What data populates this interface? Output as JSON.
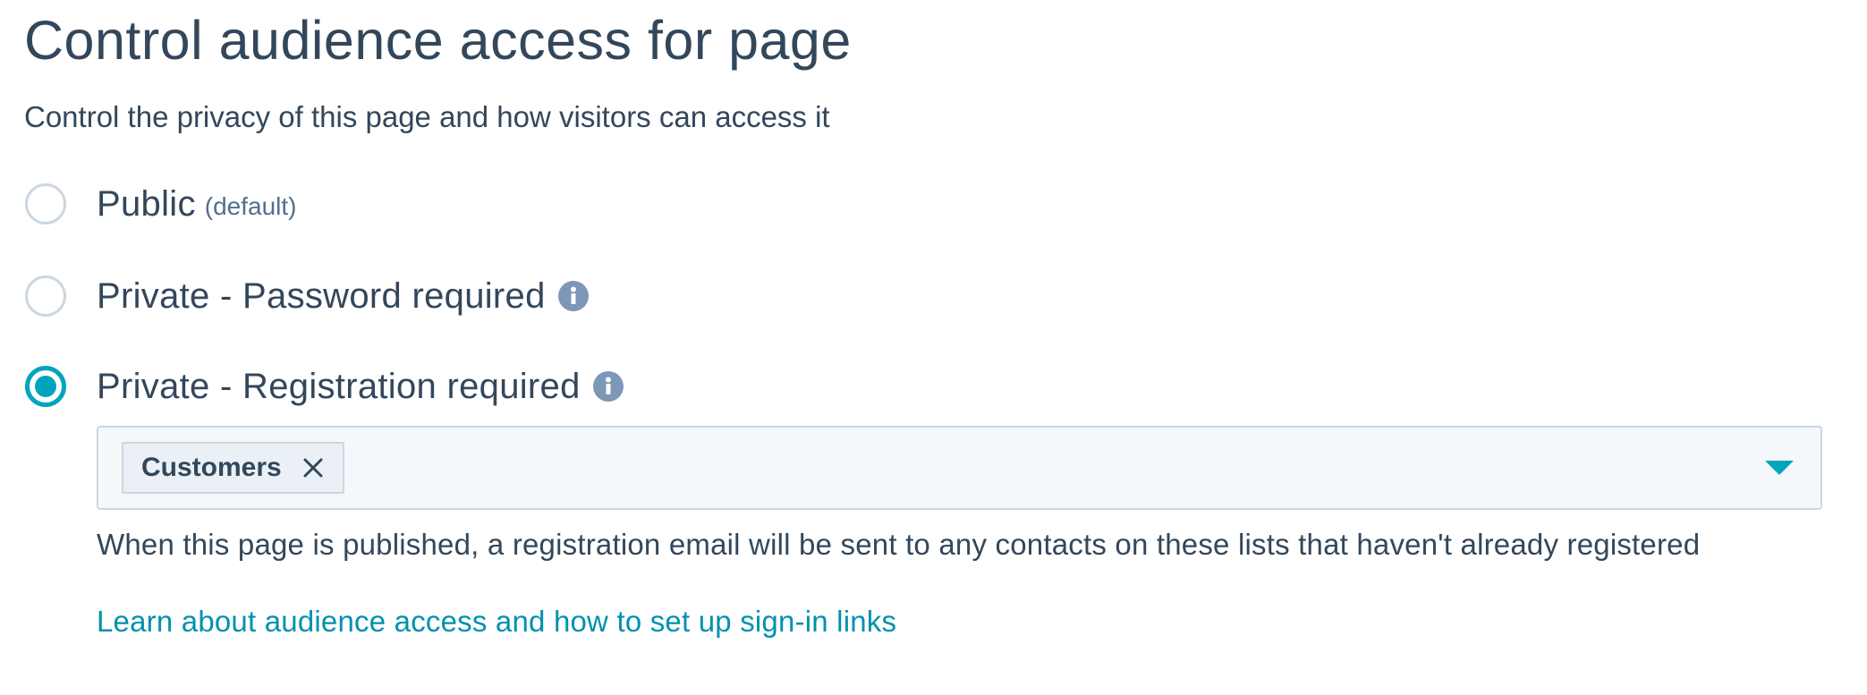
{
  "page": {
    "title": "Control audience access for page",
    "subtitle": "Control the privacy of this page and how visitors can access it"
  },
  "options": [
    {
      "label": "Public",
      "hint": "(default)",
      "selected": false
    },
    {
      "label": "Private - Password required",
      "selected": false,
      "info_icon": "info-icon"
    },
    {
      "label": "Private - Registration required",
      "selected": true,
      "info_icon": "info-icon"
    }
  ],
  "list_select": {
    "tags": [
      {
        "label": "Customers",
        "remove_icon": "close-icon"
      }
    ],
    "caret_icon": "caret-down-icon"
  },
  "help_text": "When this page is published, a registration email will be sent to any contacts on these lists that haven't already registered",
  "learn_link": "Learn about audience access and how to set up sign-in links",
  "colors": {
    "accent": "#00a4bd",
    "link": "#0091ae",
    "text": "#33475b",
    "border": "#cbd6e2",
    "info_icon_bg": "#7c98b6"
  }
}
